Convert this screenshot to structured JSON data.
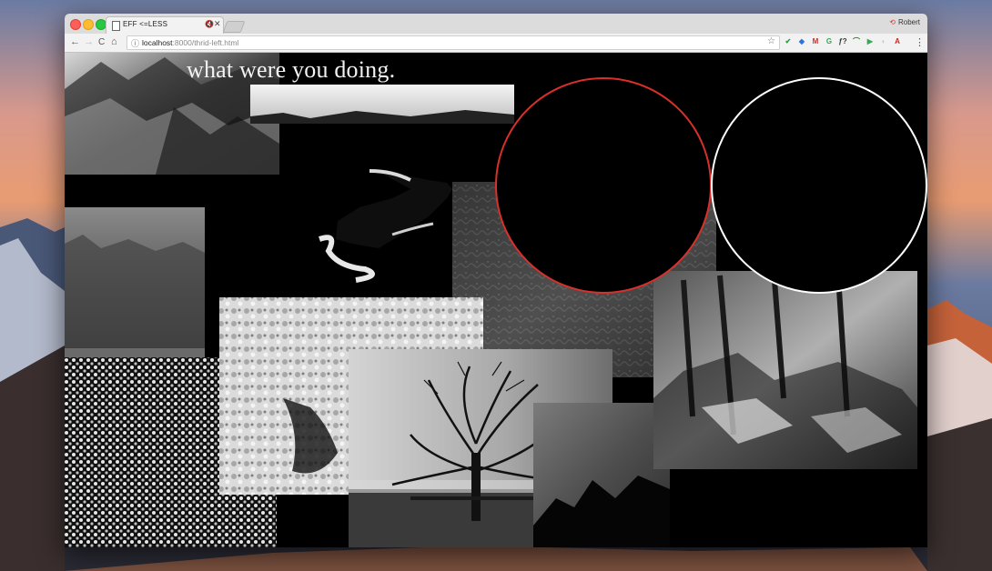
{
  "browser": {
    "tab_title": "EFF <=LESS",
    "tab_mute": "🔇",
    "tab_close": "✕",
    "profile_name": "Robert",
    "url_host": "localhost",
    "url_rest": ":8000/thrid-left.html"
  },
  "toolbar": {
    "back": "←",
    "forward": "→",
    "reload": "C",
    "home": "⌂",
    "info": "ⓘ",
    "star": "☆",
    "menu": "⋮"
  },
  "extensions": [
    {
      "label": "✔",
      "color": "#1aa33a"
    },
    {
      "label": "◆",
      "color": "#2b74e0"
    },
    {
      "label": "M",
      "color": "#c9302c"
    },
    {
      "label": "G",
      "color": "#2fa84f"
    },
    {
      "label": "ƒ?",
      "color": "#333333"
    },
    {
      "label": "⌒",
      "color": "#228b22"
    },
    {
      "label": "▶",
      "color": "#34a853"
    },
    {
      "label": "◐",
      "color": "#c8c8c8"
    },
    {
      "label": "A",
      "color": "#d02020"
    }
  ],
  "page": {
    "heading": "what were you doing."
  },
  "colors": {
    "accent_red_circle": "#d9302a",
    "white_circle": "#ffffff",
    "page_bg": "#000000"
  }
}
